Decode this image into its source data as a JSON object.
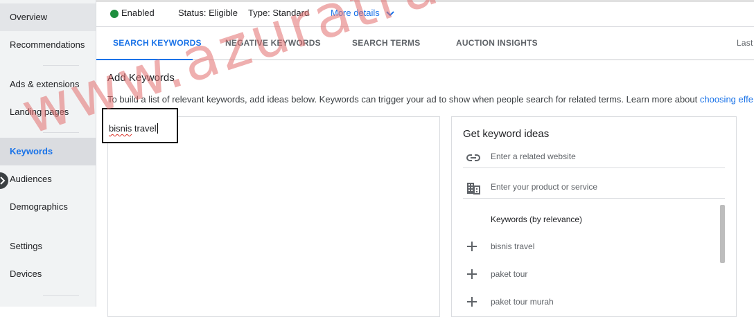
{
  "sidebar": {
    "items": [
      {
        "label": "Overview"
      },
      {
        "label": "Recommendations"
      },
      {
        "label": "Ads & extensions"
      },
      {
        "label": "Landing pages"
      },
      {
        "label": "Keywords"
      },
      {
        "label": "Audiences"
      },
      {
        "label": "Demographics"
      },
      {
        "label": "Settings"
      },
      {
        "label": "Devices"
      }
    ],
    "active": "Keywords"
  },
  "status_bar": {
    "state": "Enabled",
    "state_color": "#1e8e3e",
    "status": "Status: Eligible",
    "type": "Type: Standard",
    "more_details": "More details"
  },
  "tabs": [
    {
      "label": "SEARCH KEYWORDS",
      "active": true
    },
    {
      "label": "NEGATIVE KEYWORDS"
    },
    {
      "label": "SEARCH TERMS"
    },
    {
      "label": "AUCTION INSIGHTS"
    },
    {
      "label": "Last"
    }
  ],
  "main": {
    "heading": "Add Keywords",
    "description": "To build a list of relevant keywords, add ideas below. Keywords can trigger your ad to show when people search for related terms. Learn more about ",
    "description_link": "choosing effe",
    "keyword_input": {
      "word1": "bisnis",
      "word2": "travel"
    }
  },
  "ideas": {
    "title": "Get keyword ideas",
    "website_placeholder": "Enter a related website",
    "product_placeholder": "Enter your product or service",
    "sort_label": "Keywords (by relevance)",
    "suggestions": [
      {
        "label": "bisnis travel"
      },
      {
        "label": "paket tour"
      },
      {
        "label": "paket tour murah"
      }
    ]
  },
  "watermark": "www.azuratravel.com",
  "colors": {
    "accent": "#1a73e8",
    "watermark": "#e16e6e"
  }
}
